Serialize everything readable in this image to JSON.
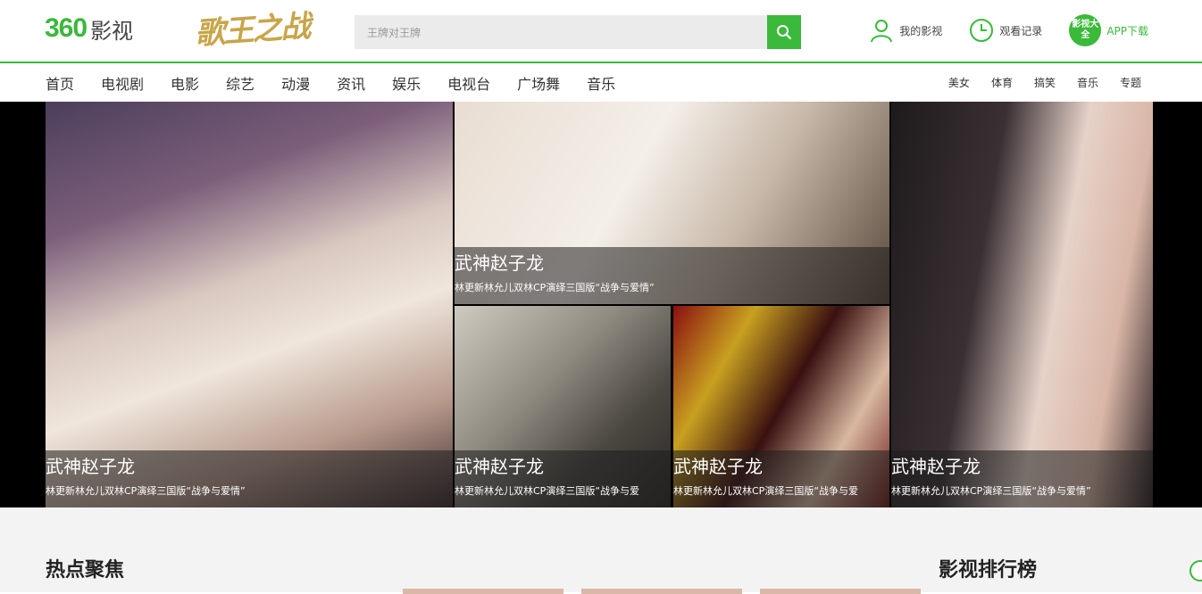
{
  "header": {
    "logo_number": "360",
    "logo_text": "影视",
    "promo_text": "歌王之战",
    "search": {
      "placeholder": "王牌对王牌"
    },
    "links": [
      {
        "label": "我的影视",
        "icon": "user-icon"
      },
      {
        "label": "观看记录",
        "icon": "clock-icon"
      },
      {
        "label": "APP下载",
        "icon": "app-badge",
        "badge": "影视大全"
      }
    ]
  },
  "nav": {
    "main": [
      "首页",
      "电视剧",
      "电影",
      "综艺",
      "动漫",
      "资讯",
      "娱乐",
      "电视台",
      "广场舞",
      "音乐"
    ],
    "sub": [
      "美女",
      "体育",
      "搞笑",
      "音乐",
      "专题"
    ]
  },
  "hero": {
    "tiles": [
      {
        "title": "武神赵子龙",
        "desc": "林更新林允儿双林CP演绎三国版“战争与爱情”"
      },
      {
        "title": "武神赵子龙",
        "desc": "林更新林允儿双林CP演绎三国版“战争与爱情”"
      },
      {
        "title": "武神赵子龙",
        "desc": "林更新林允儿双林CP演绎三国版“战争与爱情”"
      },
      {
        "title": "武神赵子龙",
        "desc": "林更新林允儿双林CP演绎三国版“战争与爱"
      },
      {
        "title": "武神赵子龙",
        "desc": "林更新林允儿双林CP演绎三国版“战争与爱"
      },
      {
        "title": "武神赵子龙",
        "desc": "林更新林允儿双林CP演绎三国版“战争与爱情”"
      }
    ]
  },
  "sections": {
    "hot": "热点聚焦",
    "rank": "影视排行榜"
  },
  "colors": {
    "accent": "#3ab93a"
  }
}
